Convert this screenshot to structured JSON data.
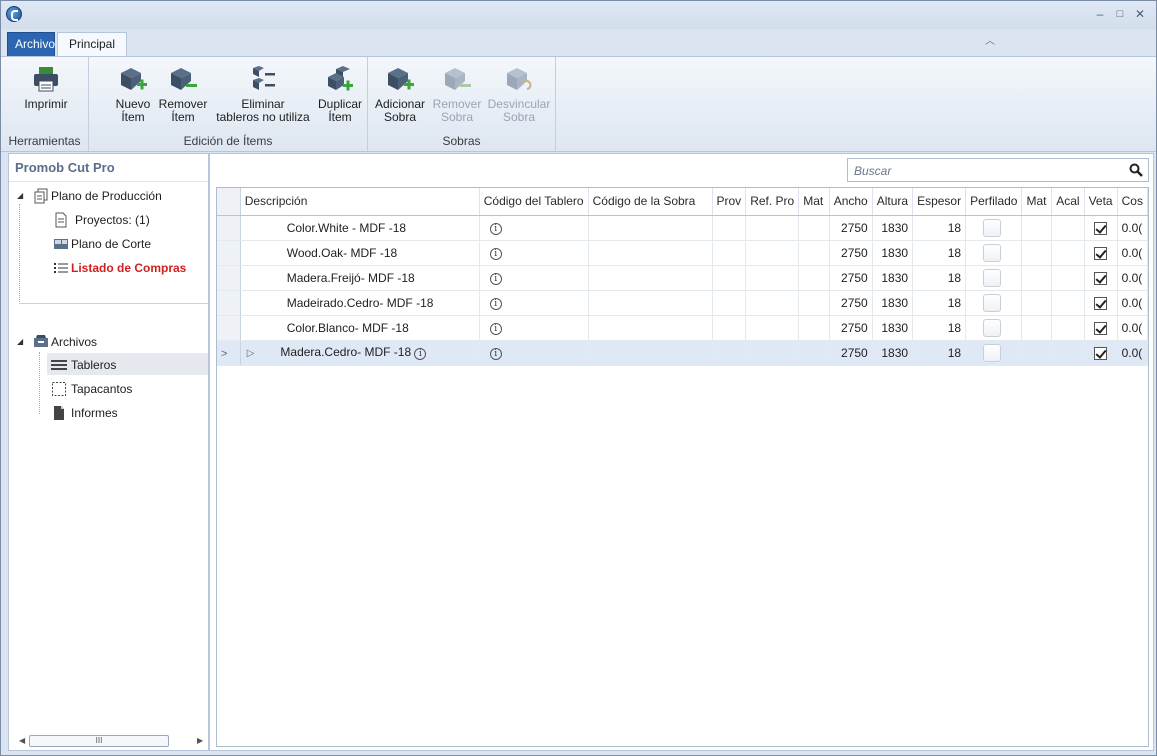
{
  "titlebar": {
    "minimize": "‒",
    "maximize": "□",
    "close": "✕"
  },
  "tabs": [
    {
      "label": "Archivo"
    },
    {
      "label": "Principal"
    }
  ],
  "ribbon": {
    "groups": [
      {
        "label": "Herramientas",
        "buttons": [
          {
            "label": "Imprimir"
          }
        ]
      },
      {
        "label": "Edición de Ítems",
        "buttons": [
          {
            "label": "Nuevo\nÍtem"
          },
          {
            "label": "Remover\nÍtem"
          },
          {
            "label": "Eliminar\ntableros no utiliza"
          },
          {
            "label": "Duplicar\nÍtem"
          }
        ]
      },
      {
        "label": "Sobras",
        "buttons": [
          {
            "label": "Adicionar\nSobra"
          },
          {
            "label": "Remover\nSobra"
          },
          {
            "label": "Desvincular\nSobra"
          }
        ]
      }
    ]
  },
  "sidebar": {
    "title": "Promob Cut Pro",
    "tree1": {
      "root": "Plano de Producción",
      "items": [
        "Proyectos: (1)",
        "Plano de Corte",
        "Listado de Compras"
      ]
    },
    "tree2": {
      "root": "Archivos",
      "items": [
        "Tableros",
        "Tapacantos",
        "Informes"
      ]
    },
    "scroll_thumb": "III"
  },
  "search": {
    "placeholder": "Buscar"
  },
  "table": {
    "columns": [
      "Descripción",
      "Código del Tablero",
      "Código de la Sobra",
      "Prov",
      "Ref. Pro",
      "Mat",
      "Ancho",
      "Altura",
      "Espesor",
      "Perfilado",
      "Mat",
      "Acal",
      "Veta",
      "Cos"
    ],
    "rows": [
      {
        "desc": "Color.White - MDF -18",
        "ancho": "2750",
        "altura": "1830",
        "espesor": "18",
        "cos": "0.0("
      },
      {
        "desc": "Wood.Oak- MDF -18",
        "ancho": "2750",
        "altura": "1830",
        "espesor": "18",
        "cos": "0.0("
      },
      {
        "desc": "Madera.Freijó- MDF -18",
        "ancho": "2750",
        "altura": "1830",
        "espesor": "18",
        "cos": "0.0("
      },
      {
        "desc": "Madeirado.Cedro- MDF -18",
        "ancho": "2750",
        "altura": "1830",
        "espesor": "18",
        "cos": "0.0("
      },
      {
        "desc": "Color.Blanco- MDF -18",
        "ancho": "2750",
        "altura": "1830",
        "espesor": "18",
        "cos": "0.0("
      },
      {
        "desc": "Madera.Cedro- MDF -18",
        "ancho": "2750",
        "altura": "1830",
        "espesor": "18",
        "cos": "0.0("
      }
    ],
    "info_glyph": "i",
    "selected_row_marker": ">",
    "expand_marker": "▷"
  },
  "colors": {
    "accent": "#2c66b3",
    "active_link": "#d21f1f",
    "status_green": "#8db98d"
  }
}
